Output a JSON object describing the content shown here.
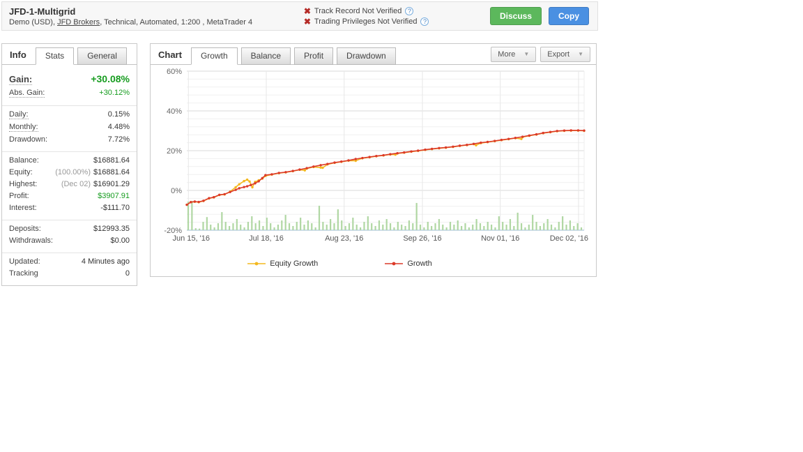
{
  "header": {
    "title": "JFD-1-Multigrid",
    "subtitle_prefix": "Demo (USD), ",
    "broker_link": "JFD Brokers",
    "subtitle_suffix": ", Technical, Automated, 1:200 , MetaTrader 4",
    "verifications": [
      {
        "text": "Track Record Not Verified",
        "icon": "x-mark",
        "help": "?"
      },
      {
        "text": "Trading Privileges Not Verified",
        "icon": "x-mark",
        "help": "?"
      }
    ],
    "discuss_label": "Discuss",
    "copy_label": "Copy"
  },
  "info_panel": {
    "title_tab": "Info",
    "tabs": [
      {
        "label": "Stats",
        "active": true
      },
      {
        "label": "General",
        "active": false
      }
    ],
    "groups": [
      [
        {
          "label": "Gain:",
          "value": "+30.08%",
          "dotted": true,
          "big": true,
          "valueClass": "green"
        },
        {
          "label": "Abs. Gain:",
          "value": "+30.12%",
          "dotted": true,
          "valueClass": "green"
        }
      ],
      [
        {
          "label": "Daily:",
          "value": "0.15%",
          "dotted": true
        },
        {
          "label": "Monthly:",
          "value": "4.48%",
          "dotted": true
        },
        {
          "label": "Drawdown:",
          "value": "7.72%"
        }
      ],
      [
        {
          "label": "Balance:",
          "value": "$16881.64"
        },
        {
          "label": "Equity:",
          "pre": "(100.00%)",
          "value": "$16881.64"
        },
        {
          "label": "Highest:",
          "pre": "(Dec 02)",
          "value": "$16901.29"
        },
        {
          "label": "Profit:",
          "value": "$3907.91",
          "valueClass": "green"
        },
        {
          "label": "Interest:",
          "value": "-$111.70"
        }
      ],
      [
        {
          "label": "Deposits:",
          "value": "$12993.35"
        },
        {
          "label": "Withdrawals:",
          "value": "$0.00"
        }
      ],
      [
        {
          "label": "Updated:",
          "value": "4 Minutes ago"
        },
        {
          "label": "Tracking",
          "value": "0"
        }
      ]
    ]
  },
  "chart_panel": {
    "title_tab": "Chart",
    "tabs": [
      {
        "label": "Growth",
        "active": true
      },
      {
        "label": "Balance",
        "active": false
      },
      {
        "label": "Profit",
        "active": false
      },
      {
        "label": "Drawdown",
        "active": false
      }
    ],
    "more_label": "More",
    "export_label": "Export",
    "dropdown_arrow": "▼"
  },
  "chart_data": {
    "type": "line",
    "title": "Account Growth",
    "ylabel": "%",
    "ylim": [
      -20,
      60
    ],
    "y_ticks": [
      60,
      40,
      20,
      0,
      -20
    ],
    "y_tick_suffix": "%",
    "minor_grid_step_pct": 4,
    "grid": true,
    "x_ticks": [
      {
        "frac": 0.004,
        "label": "Jun 15, '16"
      },
      {
        "frac": 0.2,
        "label": "Jul 18, '16"
      },
      {
        "frac": 0.396,
        "label": "Aug 23, '16"
      },
      {
        "frac": 0.593,
        "label": "Sep 26, '16"
      },
      {
        "frac": 0.789,
        "label": "Nov 01, '16"
      },
      {
        "frac": 0.986,
        "label": "Dec 02, '16"
      }
    ],
    "legend_position": "bottom",
    "series": [
      {
        "name": "Equity Growth",
        "color": "#f3b81f",
        "points": [
          [
            0,
            -7.2
          ],
          [
            0.01,
            -5.9
          ],
          [
            0.02,
            -5.7
          ],
          [
            0.03,
            -5.9
          ],
          [
            0.042,
            -5.3
          ],
          [
            0.056,
            -4.0
          ],
          [
            0.068,
            -3.5
          ],
          [
            0.082,
            -2.3
          ],
          [
            0.095,
            -2.0
          ],
          [
            0.109,
            -0.6
          ],
          [
            0.123,
            1.6
          ],
          [
            0.132,
            3.1
          ],
          [
            0.144,
            4.7
          ],
          [
            0.152,
            5.4
          ],
          [
            0.158,
            4.5
          ],
          [
            0.165,
            1.6
          ],
          [
            0.172,
            4.3
          ],
          [
            0.181,
            5.1
          ],
          [
            0.19,
            5.9
          ],
          [
            0.198,
            7.3
          ],
          [
            0.214,
            8.0
          ],
          [
            0.232,
            8.7
          ],
          [
            0.249,
            9.1
          ],
          [
            0.267,
            9.7
          ],
          [
            0.284,
            10.4
          ],
          [
            0.297,
            10.1
          ],
          [
            0.302,
            11.0
          ],
          [
            0.319,
            11.8
          ],
          [
            0.337,
            11.5
          ],
          [
            0.342,
            11.4
          ],
          [
            0.354,
            13.1
          ],
          [
            0.372,
            13.9
          ],
          [
            0.389,
            14.4
          ],
          [
            0.407,
            15.0
          ],
          [
            0.425,
            14.9
          ],
          [
            0.442,
            16.2
          ],
          [
            0.46,
            16.7
          ],
          [
            0.477,
            17.2
          ],
          [
            0.495,
            17.6
          ],
          [
            0.512,
            18.1
          ],
          [
            0.525,
            18.0
          ],
          [
            0.53,
            18.6
          ],
          [
            0.547,
            19.0
          ],
          [
            0.565,
            19.5
          ],
          [
            0.582,
            19.9
          ],
          [
            0.6,
            20.4
          ],
          [
            0.617,
            20.8
          ],
          [
            0.635,
            21.2
          ],
          [
            0.652,
            21.5
          ],
          [
            0.67,
            21.9
          ],
          [
            0.687,
            22.4
          ],
          [
            0.705,
            22.8
          ],
          [
            0.722,
            23.3
          ],
          [
            0.728,
            22.7
          ],
          [
            0.74,
            23.8
          ],
          [
            0.757,
            24.3
          ],
          [
            0.775,
            24.8
          ],
          [
            0.792,
            25.3
          ],
          [
            0.81,
            25.8
          ],
          [
            0.827,
            26.3
          ],
          [
            0.842,
            25.9
          ],
          [
            0.845,
            26.8
          ],
          [
            0.862,
            27.5
          ],
          [
            0.88,
            28.1
          ],
          [
            0.897,
            28.8
          ],
          [
            0.915,
            29.3
          ],
          [
            0.932,
            29.8
          ],
          [
            0.95,
            30.0
          ],
          [
            0.967,
            30.1
          ],
          [
            0.985,
            30.1
          ],
          [
            1,
            30.0
          ]
        ]
      },
      {
        "name": "Growth",
        "color": "#dc3a28",
        "points": [
          [
            0,
            -7.2
          ],
          [
            0.01,
            -5.9
          ],
          [
            0.02,
            -5.6
          ],
          [
            0.03,
            -5.8
          ],
          [
            0.042,
            -5.2
          ],
          [
            0.056,
            -3.9
          ],
          [
            0.068,
            -3.4
          ],
          [
            0.082,
            -2.2
          ],
          [
            0.095,
            -1.9
          ],
          [
            0.109,
            -0.8
          ],
          [
            0.123,
            0.3
          ],
          [
            0.132,
            1.1
          ],
          [
            0.144,
            1.7
          ],
          [
            0.152,
            2.1
          ],
          [
            0.161,
            2.7
          ],
          [
            0.172,
            3.6
          ],
          [
            0.181,
            4.6
          ],
          [
            0.19,
            6.2
          ],
          [
            0.198,
            7.7
          ],
          [
            0.214,
            8.1
          ],
          [
            0.232,
            8.8
          ],
          [
            0.249,
            9.2
          ],
          [
            0.267,
            9.8
          ],
          [
            0.284,
            10.5
          ],
          [
            0.302,
            11.2
          ],
          [
            0.319,
            12.0
          ],
          [
            0.337,
            12.7
          ],
          [
            0.354,
            13.3
          ],
          [
            0.372,
            14.0
          ],
          [
            0.389,
            14.5
          ],
          [
            0.407,
            15.1
          ],
          [
            0.425,
            15.8
          ],
          [
            0.442,
            16.3
          ],
          [
            0.46,
            16.8
          ],
          [
            0.477,
            17.3
          ],
          [
            0.495,
            17.7
          ],
          [
            0.512,
            18.2
          ],
          [
            0.53,
            18.7
          ],
          [
            0.547,
            19.1
          ],
          [
            0.565,
            19.6
          ],
          [
            0.582,
            20.0
          ],
          [
            0.6,
            20.5
          ],
          [
            0.617,
            20.9
          ],
          [
            0.635,
            21.3
          ],
          [
            0.652,
            21.6
          ],
          [
            0.67,
            22.0
          ],
          [
            0.687,
            22.5
          ],
          [
            0.705,
            22.9
          ],
          [
            0.722,
            23.4
          ],
          [
            0.74,
            24.0
          ],
          [
            0.757,
            24.4
          ],
          [
            0.775,
            24.9
          ],
          [
            0.792,
            25.4
          ],
          [
            0.81,
            25.9
          ],
          [
            0.827,
            26.4
          ],
          [
            0.845,
            27.0
          ],
          [
            0.862,
            27.6
          ],
          [
            0.88,
            28.2
          ],
          [
            0.897,
            28.9
          ],
          [
            0.915,
            29.4
          ],
          [
            0.932,
            29.9
          ],
          [
            0.95,
            30.1
          ],
          [
            0.967,
            30.2
          ],
          [
            0.985,
            30.2
          ],
          [
            1,
            30.1
          ]
        ]
      }
    ],
    "bars": {
      "name": "daily-activity-bars",
      "color": "#b0d7a3",
      "baseline_pct": -20,
      "values_pct": [
        14.4,
        14.7,
        1.0,
        0.8,
        4.2,
        6.6,
        2.8,
        1.4,
        3.5,
        9.1,
        4.2,
        2.1,
        3.5,
        5.6,
        2.8,
        1.4,
        4.2,
        7.0,
        3.5,
        4.9,
        2.1,
        6.3,
        3.5,
        1.4,
        2.8,
        4.9,
        7.7,
        3.5,
        2.1,
        4.2,
        6.3,
        2.8,
        4.9,
        3.5,
        1.4,
        12.3,
        4.2,
        2.8,
        5.6,
        3.5,
        10.5,
        4.9,
        2.1,
        3.5,
        6.3,
        2.8,
        1.4,
        4.2,
        7.0,
        3.5,
        2.1,
        4.9,
        2.8,
        5.6,
        3.5,
        1.4,
        4.2,
        2.8,
        2.1,
        4.9,
        3.5,
        13.7,
        2.8,
        1.4,
        4.2,
        2.1,
        3.5,
        5.6,
        2.8,
        1.4,
        4.2,
        2.8,
        4.9,
        2.1,
        3.5,
        1.4,
        2.8,
        5.6,
        3.5,
        2.1,
        4.2,
        2.8,
        1.4,
        7.0,
        4.2,
        2.8,
        5.6,
        2.1,
        8.8,
        3.5,
        1.4,
        2.8,
        7.7,
        4.2,
        2.1,
        3.5,
        5.6,
        2.8,
        1.4,
        4.2,
        7.0,
        2.8,
        4.9,
        2.1,
        3.5,
        1.4
      ]
    },
    "colors": {
      "major_grid": "#dadada",
      "minor_grid": "#f0f0f0",
      "axis_text": "#666",
      "baseline": "#aec8dc"
    }
  },
  "legend": [
    {
      "label": "Equity Growth",
      "color": "#f3b81f"
    },
    {
      "label": "Growth",
      "color": "#dc3a28"
    }
  ]
}
